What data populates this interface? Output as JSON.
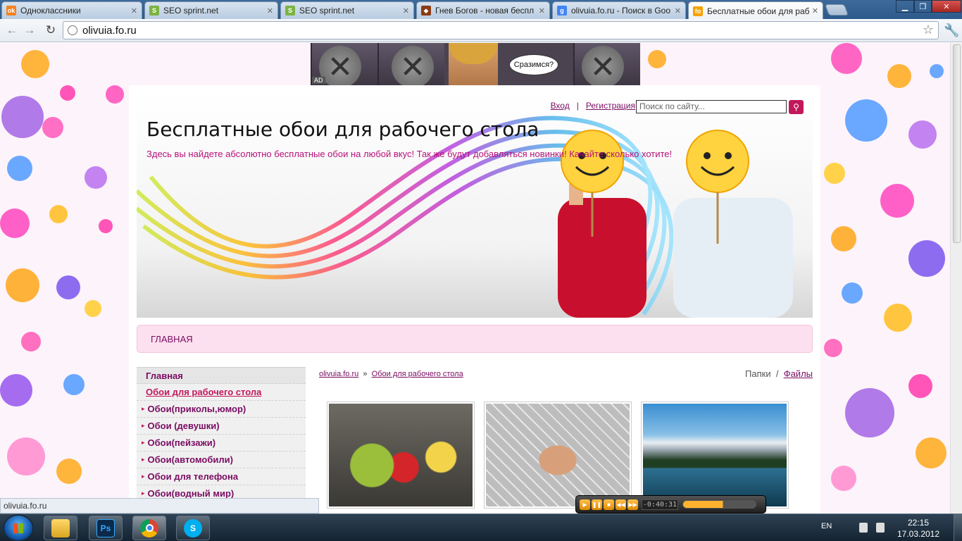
{
  "browser": {
    "tabs": [
      {
        "title": "Одноклассники",
        "favicon": "ok-icon",
        "favicon_color": "#f58220"
      },
      {
        "title": "SEO sprint.net",
        "favicon": "seosprint-icon",
        "favicon_color": "#7cb342"
      },
      {
        "title": "SEO sprint.net",
        "favicon": "seosprint-icon",
        "favicon_color": "#7cb342"
      },
      {
        "title": "Гнев Богов - новая беспл",
        "favicon": "game-icon",
        "favicon_color": "#8a3b12"
      },
      {
        "title": "olivuia.fo.ru - Поиск в Goo",
        "favicon": "google-icon",
        "favicon_color": "#4285f4"
      },
      {
        "title": "Бесплатные обои для рабо",
        "favicon": "fo-icon",
        "favicon_color": "#f5a300",
        "active": true
      }
    ],
    "url": "olivuia.fo.ru",
    "status_text": "olivuia.fo.ru"
  },
  "ad": {
    "speech": "Сразимся?",
    "label": "AD"
  },
  "site": {
    "login": "Вход",
    "separator": "|",
    "register": "Регистрация",
    "search_placeholder": "Поиск по сайту...",
    "title": "Бесплатные обои для рабочего стола",
    "description": "Здесь вы найдете абсолютно бесплатные обои на любой вкус! Так же будут добавляться новинки! Качайте сколько хотите!",
    "menu": [
      "ГЛАВНАЯ"
    ]
  },
  "sidebar": {
    "items": [
      {
        "label": "Главная"
      },
      {
        "label": "Обои для рабочего стола"
      },
      {
        "label": "Обои(приколы,юмор)"
      },
      {
        "label": "Обои (девушки)"
      },
      {
        "label": "Обои(пейзажи)"
      },
      {
        "label": "Обои(автомобили)"
      },
      {
        "label": "Обои для телефона"
      },
      {
        "label": "Обои(водный мир)"
      }
    ]
  },
  "breadcrumb": {
    "home": "olivuia.fo.ru",
    "separator": "»",
    "current": "Обои для рабочего стола"
  },
  "view_switch": {
    "folders": "Папки",
    "separator": "/",
    "files": "Файлы"
  },
  "thumbnails": [
    {
      "name": "fruits-cartoon"
    },
    {
      "name": "girl-football-net"
    },
    {
      "name": "mountain-lake"
    }
  ],
  "player": {
    "time": "-0:40:31",
    "volume_fraction": 0.55
  },
  "taskbar": {
    "apps": [
      "explorer",
      "photoshop",
      "chrome",
      "skype"
    ],
    "photoshop_label": "Ps",
    "lang": "EN",
    "time": "22:15",
    "date": "17.03.2012"
  },
  "colors": {
    "accent": "#c2185b",
    "link": "#7a0c62",
    "menu_bg": "#fde0ef"
  }
}
